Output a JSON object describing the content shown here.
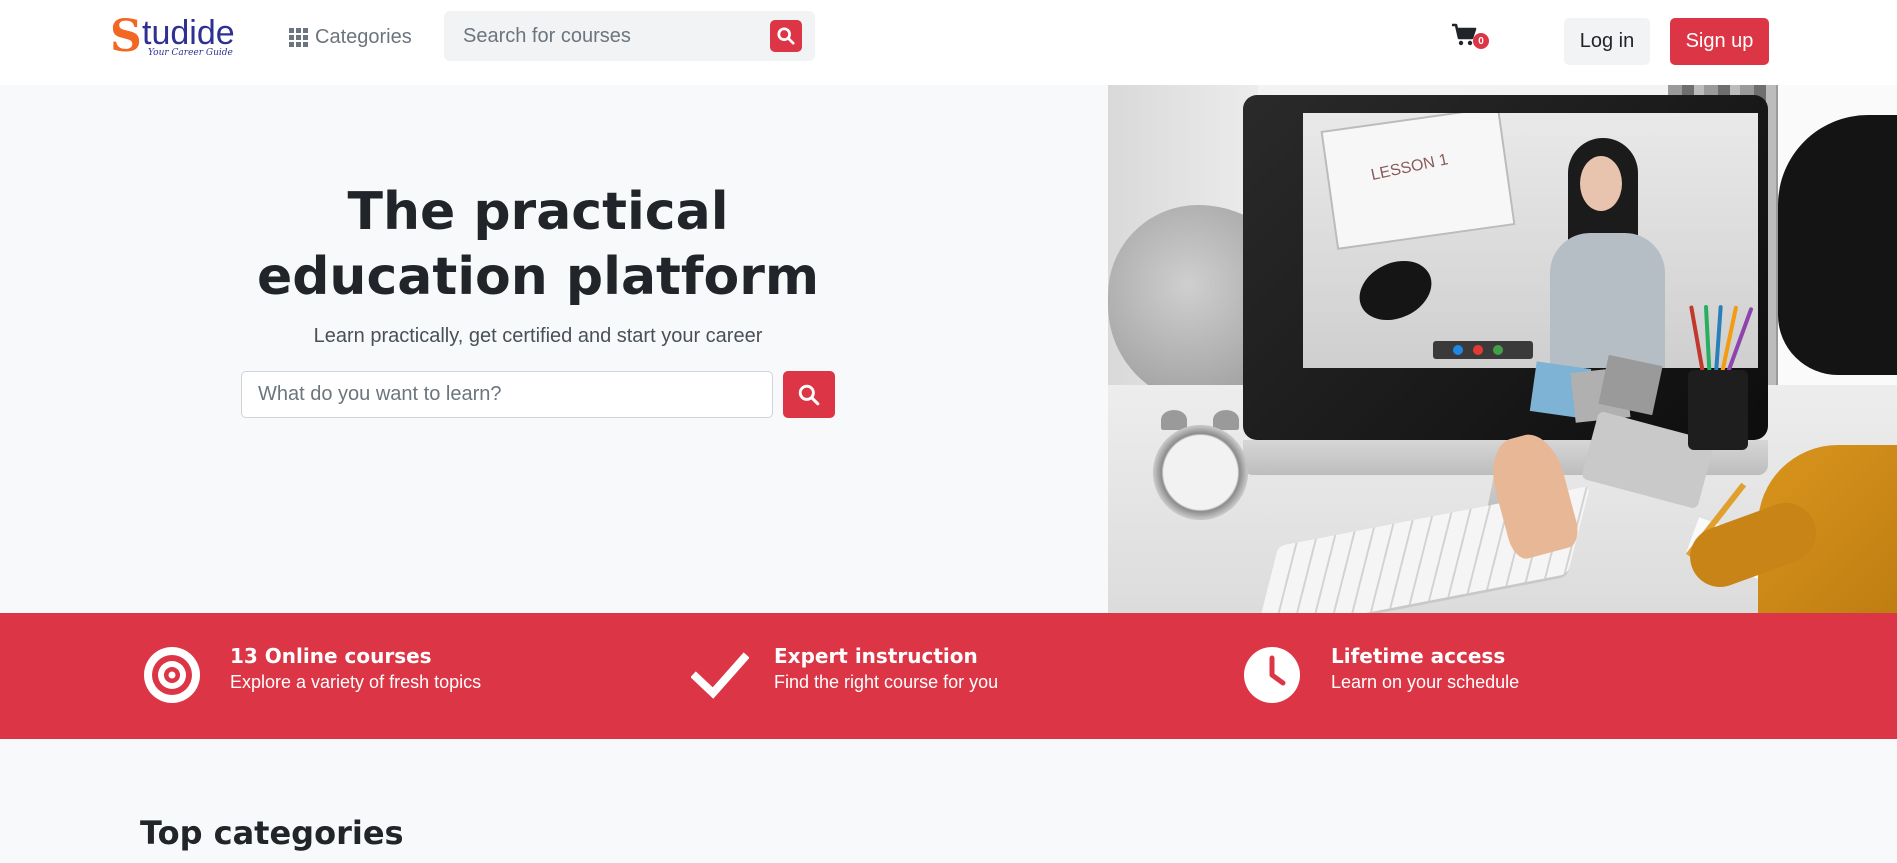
{
  "header": {
    "logo": {
      "text_first": "S",
      "text_rest": "tudide",
      "tagline": "Your Career Guide"
    },
    "categories_label": "Categories",
    "search": {
      "placeholder": "Search for courses"
    },
    "cart": {
      "count": "0"
    },
    "login_label": "Log in",
    "signup_label": "Sign up"
  },
  "hero": {
    "title": "The practical education platform",
    "subtitle": "Learn practically, get certified and start your career",
    "search": {
      "placeholder": "What do you want to learn?"
    },
    "image": {
      "board_text": "LESSON 1"
    }
  },
  "features": [
    {
      "icon": "target-icon",
      "title": "13 Online courses",
      "subtitle": "Explore a variety of fresh topics"
    },
    {
      "icon": "check-icon",
      "title": "Expert instruction",
      "subtitle": "Find the right course for you"
    },
    {
      "icon": "clock-icon",
      "title": "Lifetime access",
      "subtitle": "Learn on your schedule"
    }
  ],
  "sections": {
    "top_categories": "Top categories"
  },
  "colors": {
    "accent": "#dc3545",
    "logo_orange": "#f26722",
    "logo_blue": "#2e3192",
    "background": "#f8f9fa",
    "text": "#212529"
  }
}
